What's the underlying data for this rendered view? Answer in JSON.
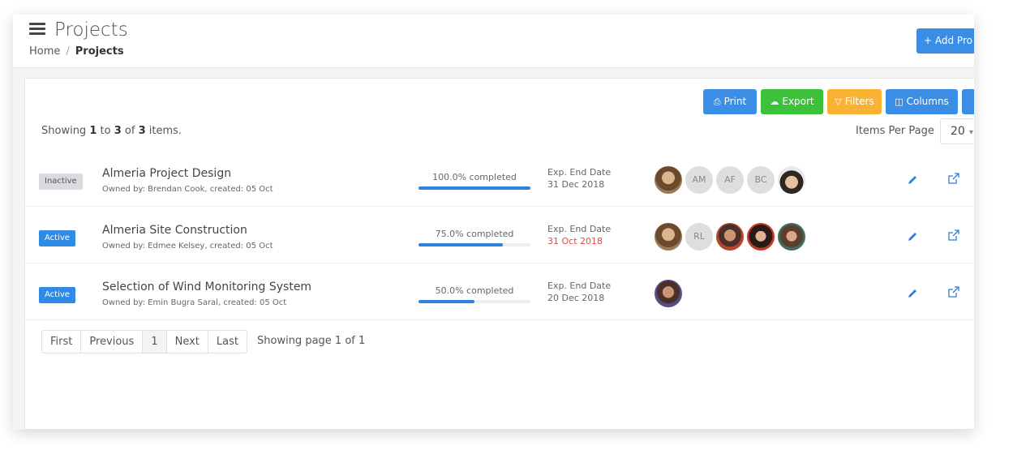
{
  "header": {
    "title": "Projects",
    "breadcrumb": {
      "home": "Home",
      "separator": "/",
      "current": "Projects"
    },
    "add_button_label": "+ Add Pro"
  },
  "toolbar": {
    "print": "Print",
    "export": "Export",
    "filters": "Filters",
    "columns": "Columns"
  },
  "summary": {
    "prefix": "Showing",
    "from": "1",
    "to_word": "to",
    "to": "3",
    "of_word": "of",
    "total": "3",
    "suffix": "items."
  },
  "items_per_page": {
    "label": "Items Per Page",
    "value": "20"
  },
  "projects": [
    {
      "status": "Inactive",
      "name": "Almeria Project Design",
      "owner": "Owned by: Brendan Cook, created: 05 Oct",
      "progress_label": "100.0% completed",
      "progress": 100,
      "exp_label": "Exp. End Date",
      "exp_date": "31 Dec 2018",
      "overdue": false,
      "members": [
        "photo",
        "AM",
        "AF",
        "BC",
        "photo"
      ]
    },
    {
      "status": "Active",
      "name": "Almeria Site Construction",
      "owner": "Owned by: Edmee Kelsey, created: 05 Oct",
      "progress_label": "75.0% completed",
      "progress": 75,
      "exp_label": "Exp. End Date",
      "exp_date": "31 Oct 2018",
      "overdue": true,
      "members": [
        "photo",
        "RL",
        "photo",
        "photo",
        "photo"
      ]
    },
    {
      "status": "Active",
      "name": "Selection of Wind Monitoring System",
      "owner": "Owned by: Emin Bugra Saral, created: 05 Oct",
      "progress_label": "50.0% completed",
      "progress": 50,
      "exp_label": "Exp. End Date",
      "exp_date": "20 Dec 2018",
      "overdue": false,
      "members": [
        "photo"
      ]
    }
  ],
  "pagination": {
    "first": "First",
    "previous": "Previous",
    "current": "1",
    "next": "Next",
    "last": "Last",
    "info": "Showing page 1 of 1"
  },
  "colors": {
    "primary": "#3a8ee6",
    "success": "#3cc13b",
    "warning": "#f9b233",
    "danger": "#e04a3f",
    "progress": "#2d82dc"
  }
}
